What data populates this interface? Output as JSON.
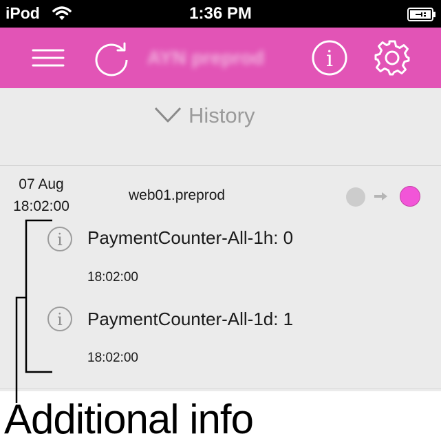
{
  "status_bar": {
    "carrier": "iPod",
    "time": "1:36 PM"
  },
  "nav": {
    "title": "AYN preprod"
  },
  "history": {
    "label": "History"
  },
  "entry": {
    "date": "07 Aug",
    "time": "18:02:00",
    "host": "web01.preprod",
    "status_from_color": "#cccccc",
    "status_to_color": "#f255d8",
    "metrics": [
      {
        "name": "PaymentCounter-All-1h: 0",
        "time": "18:02:00"
      },
      {
        "name": "PaymentCounter-All-1d: 1",
        "time": "18:02:00"
      }
    ]
  },
  "annotation": {
    "label": "Additional info"
  },
  "colors": {
    "accent": "#e254b6",
    "background": "#ebebeb"
  }
}
